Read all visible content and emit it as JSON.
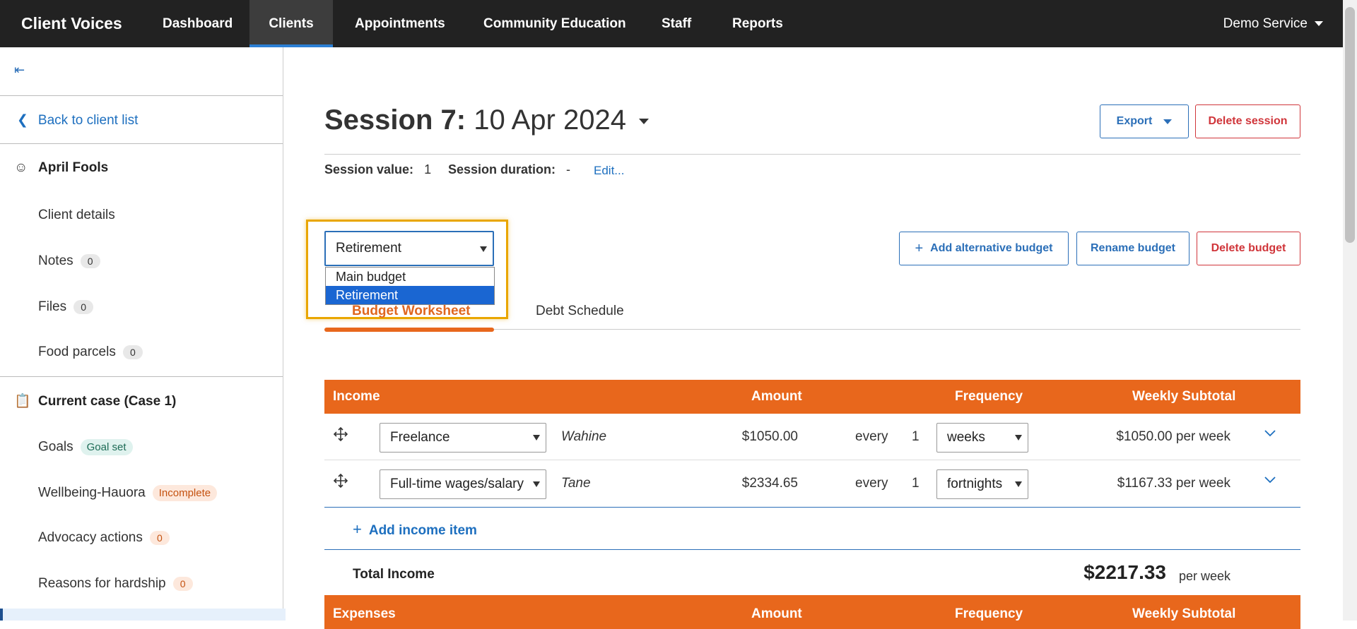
{
  "app": {
    "brand": "Client Voices",
    "service": "Demo Service"
  },
  "nav": [
    "Dashboard",
    "Clients",
    "Appointments",
    "Community Education",
    "Staff",
    "Reports"
  ],
  "sidebar": {
    "collapse_icon": "⇤",
    "back_label": "Back to client list",
    "client_name": "April Fools",
    "client_items": [
      {
        "label": "Client details"
      },
      {
        "label": "Notes",
        "count": "0"
      },
      {
        "label": "Files",
        "count": "0"
      },
      {
        "label": "Food parcels",
        "count": "0"
      }
    ],
    "case_title": "Current case (Case 1)",
    "case_items": [
      {
        "label": "Goals",
        "badge": "Goal set"
      },
      {
        "label": "Wellbeing-Hauora",
        "badge": "Incomplete"
      },
      {
        "label": "Advocacy actions",
        "count": "0"
      },
      {
        "label": "Reasons for hardship",
        "count": "0"
      }
    ]
  },
  "session": {
    "title_bold": "Session 7:",
    "title_date": "10 Apr 2024",
    "value_label": "Session value:",
    "value": "1",
    "duration_label": "Session duration:",
    "duration": "-",
    "edit_label": "Edit..."
  },
  "actions": {
    "export": "Export",
    "delete_session": "Delete session"
  },
  "budget": {
    "selected": "Retirement",
    "options": [
      "Main budget",
      "Retirement"
    ],
    "add_alt": "Add alternative budget",
    "rename": "Rename budget",
    "delete": "Delete budget"
  },
  "tabs": [
    "Budget Worksheet",
    "Debt Schedule"
  ],
  "income_table": {
    "headers": [
      "Income",
      "Amount",
      "Frequency",
      "Weekly Subtotal"
    ],
    "rows": [
      {
        "category": "Freelance",
        "person": "Wahine",
        "amount": "$1050.00",
        "every": "every",
        "num": "1",
        "freq": "weeks",
        "subtotal": "$1050.00 per week"
      },
      {
        "category": "Full-time wages/salary",
        "person": "Tane",
        "amount": "$2334.65",
        "every": "every",
        "num": "1",
        "freq": "fortnights",
        "subtotal": "$1167.33 per week"
      }
    ],
    "add_label": "Add income item",
    "total_label": "Total Income",
    "total_value": "$2217.33",
    "total_unit": "per week"
  },
  "expense_table": {
    "headers": [
      "Expenses",
      "Amount",
      "Frequency",
      "Weekly Subtotal"
    ]
  },
  "colors": {
    "accent": "#e8671c",
    "link": "#1d6fbf",
    "danger": "#d0353a",
    "focus": "#e9a600"
  }
}
